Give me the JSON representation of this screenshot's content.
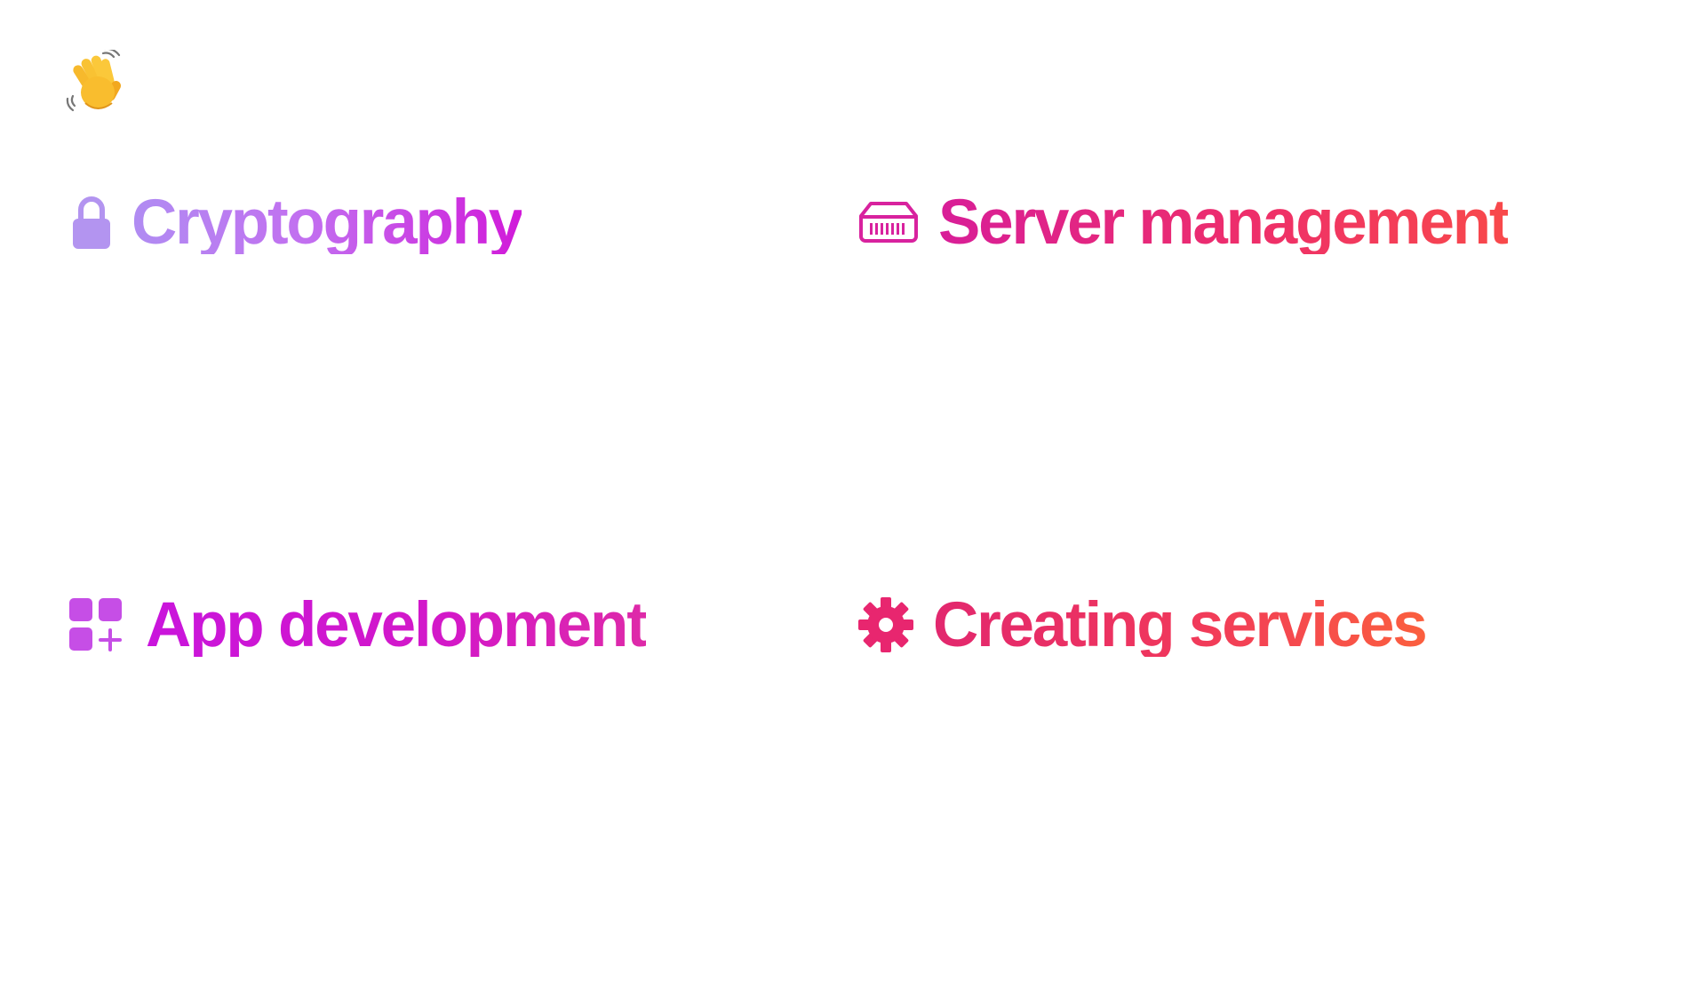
{
  "greeting": {
    "icon": "waving-hand-icon"
  },
  "features": [
    {
      "label": "Cryptography",
      "icon": "lock-icon",
      "color": "#c26ff0"
    },
    {
      "label": "Server management",
      "icon": "server-rack-icon",
      "color": "#ee2e6a"
    },
    {
      "label": "App development",
      "icon": "app-grid-plus-icon",
      "color": "#d318c8"
    },
    {
      "label": "Creating services",
      "icon": "gear-icon",
      "color": "#f0375c"
    }
  ]
}
